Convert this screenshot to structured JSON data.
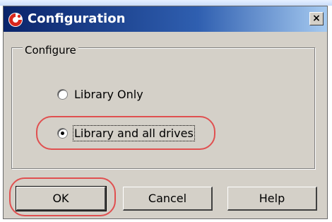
{
  "window": {
    "title": "Configuration",
    "close_glyph": "×",
    "app_icon": "red-swirl-logo-icon"
  },
  "group": {
    "label": "Configure"
  },
  "options": [
    {
      "label": "Library Only",
      "selected": false
    },
    {
      "label": "Library and all drives",
      "selected": true
    }
  ],
  "buttons": {
    "ok": "OK",
    "cancel": "Cancel",
    "help": "Help"
  },
  "colors": {
    "titlebar_start": "#0a246a",
    "titlebar_end": "#a6caf0",
    "dialog_bg": "#d4d0c8",
    "annotation_highlight": "#e05050"
  }
}
